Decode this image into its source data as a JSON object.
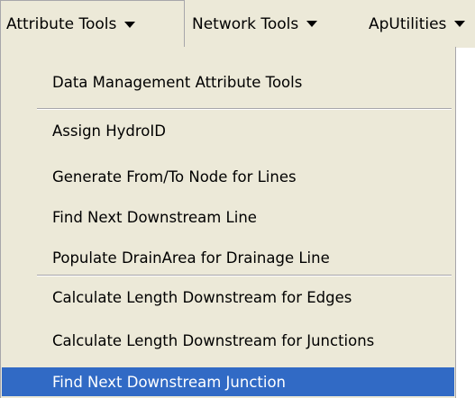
{
  "menubar": {
    "items": [
      {
        "label": "Attribute Tools",
        "active": true
      },
      {
        "label": "Network Tools",
        "active": false
      },
      {
        "label": "ApUtilities",
        "active": false
      }
    ]
  },
  "dropdown": {
    "items": [
      {
        "label": "Data Management Attribute Tools"
      },
      {
        "label": "Assign HydroID"
      },
      {
        "label": "Generate From/To Node for Lines"
      },
      {
        "label": "Find Next Downstream Line"
      },
      {
        "label": "Populate DrainArea for Drainage Line"
      },
      {
        "label": "Calculate Length Downstream for Edges"
      },
      {
        "label": "Calculate Length Downstream for Junctions"
      },
      {
        "label": "Find Next Downstream Junction",
        "highlighted": true
      }
    ]
  },
  "colors": {
    "menu_background": "#ece9d8",
    "highlight": "#316ac5",
    "highlight_text": "#ffffff",
    "separator": "#a7a6aa"
  }
}
